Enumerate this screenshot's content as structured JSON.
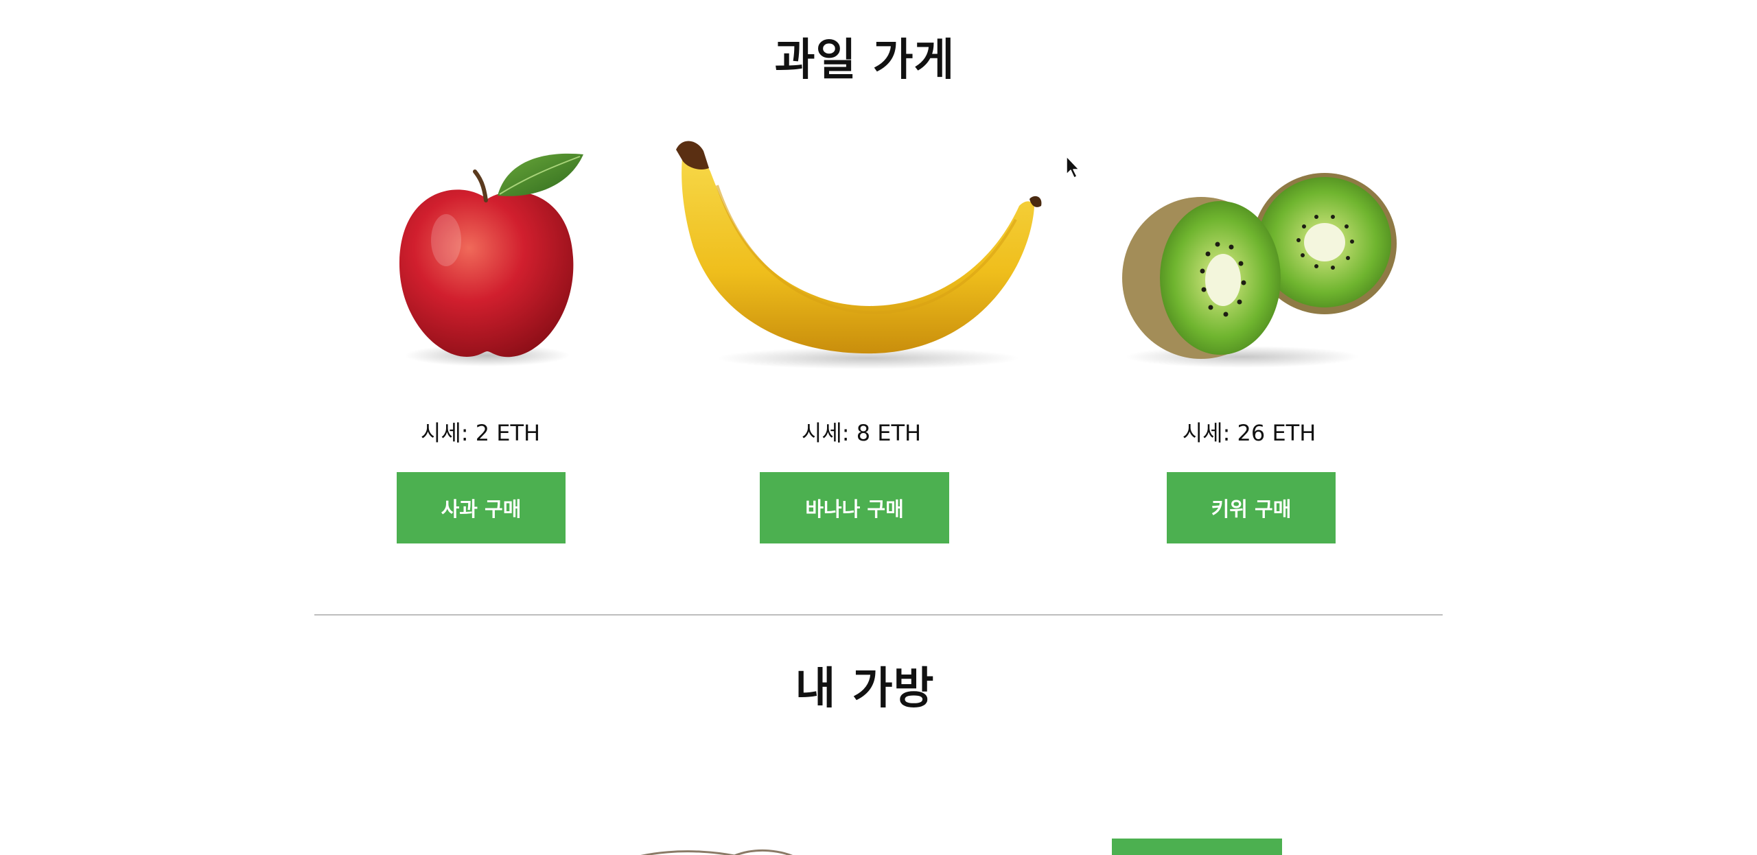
{
  "store": {
    "title": "과일 가게"
  },
  "products": [
    {
      "key": "apple",
      "icon": "apple-image",
      "price_text": "시세: 2 ETH",
      "button_label": "사과 구매",
      "colors": {
        "body": "#c0192a",
        "leaf": "#4a8a2a"
      }
    },
    {
      "key": "banana",
      "icon": "banana-image",
      "price_text": "시세: 8 ETH",
      "button_label": "바나나 구매",
      "colors": {
        "body": "#f2c623"
      }
    },
    {
      "key": "kiwi",
      "icon": "kiwi-image",
      "price_text": "시세: 26 ETH",
      "button_label": "키위 구매",
      "colors": {
        "flesh": "#7dc242",
        "skin": "#a08a55"
      }
    }
  ],
  "bag": {
    "title": "내 가방"
  },
  "colors": {
    "button": "#4cb050",
    "button_text": "#ffffff",
    "divider": "#bdbdbd",
    "text": "#111111"
  }
}
